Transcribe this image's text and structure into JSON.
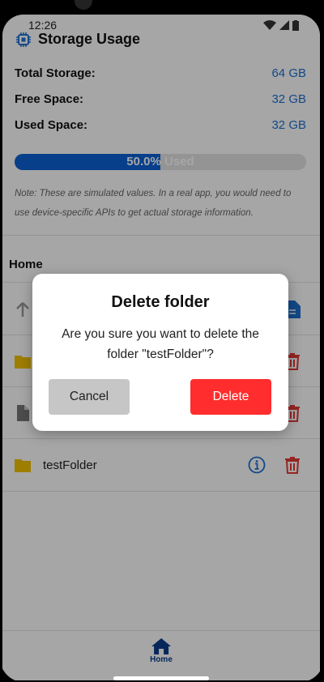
{
  "status_bar": {
    "time": "12:26"
  },
  "storage": {
    "title": "Storage Usage",
    "rows": [
      {
        "label": "Total Storage:",
        "value": "64 GB"
      },
      {
        "label": "Free Space:",
        "value": "32 GB"
      },
      {
        "label": "Used Space:",
        "value": "32 GB"
      }
    ],
    "progress_percent": 50,
    "progress_text": "50.0% Used",
    "note": "Note: These are simulated values. In a real app, you would need to use device-specific APIs to get actual storage information."
  },
  "browser": {
    "current_path": "Home",
    "items": [
      {
        "name": "testFolder",
        "icon": "folder-icon"
      }
    ]
  },
  "dialog": {
    "title": "Delete folder",
    "message": "Are you sure you want to delete the folder \"testFolder\"?",
    "cancel_label": "Cancel",
    "delete_label": "Delete"
  },
  "bottom_nav": {
    "home_label": "Home"
  },
  "colors": {
    "accent_blue": "#1e6fd0",
    "progress_fill": "#0b62d6",
    "delete_red": "#ff2d2d",
    "folder_yellow": "#f2c200",
    "trash_red": "#e53935"
  }
}
